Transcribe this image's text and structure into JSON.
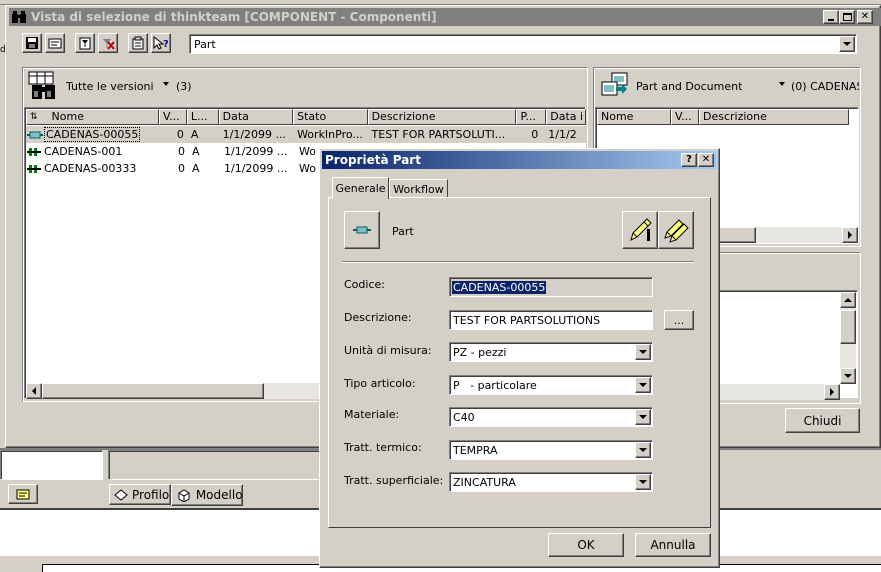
{
  "main_window": {
    "title": "Vista di selezione di thinkteam [COMPONENT - Componenti]",
    "toolbar_combo_value": "Part",
    "left_pane": {
      "versions_label": "Tutte le versioni",
      "count": "(3)",
      "columns": [
        "Nome",
        "V...",
        "L...",
        "Data",
        "Stato",
        "Descrizione",
        "P...",
        "Data i"
      ],
      "rows": [
        {
          "name": "CADENAS-00055",
          "v": "0",
          "l": "A",
          "data": "1/1/2099 ...",
          "stato": "WorkInPro...",
          "descr": "TEST FOR PARTSOLUTI...",
          "p": "0",
          "datai": "1/1/2"
        },
        {
          "name": "CADENAS-001",
          "v": "0",
          "l": "A",
          "data": "1/1/2099 ...",
          "stato": "Wo",
          "descr": "",
          "p": "",
          "datai": ""
        },
        {
          "name": "CADENAS-00333",
          "v": "0",
          "l": "A",
          "data": "1/1/2099 ...",
          "stato": "Wo",
          "descr": "",
          "p": "",
          "datai": ""
        }
      ]
    },
    "right_pane": {
      "label": "Part and Document",
      "count": "(0) CADENAS",
      "columns": [
        "Nome",
        "V...",
        "Descrizione"
      ]
    },
    "close_button": "Chiudi"
  },
  "background": {
    "tab_profilo": "Profilo",
    "tab_modello": "Modello"
  },
  "dialog": {
    "title": "Proprietà Part",
    "help": "?",
    "close": "x",
    "tabs": [
      "Generale",
      "Workflow"
    ],
    "type_label": "Part",
    "fields": {
      "codice_label": "Codice:",
      "codice_value": "CADENAS-00055",
      "descrizione_label": "Descrizione:",
      "descrizione_value": "TEST FOR PARTSOLUTIONS",
      "browse_button": "...",
      "unita_label": "Unità di misura:",
      "unita_value": "PZ - pezzi",
      "tipo_label": "Tipo articolo:",
      "tipo_value": "P   - particolare",
      "materiale_label": "Materiale:",
      "materiale_value": "C40",
      "termico_label": "Tratt. termico:",
      "termico_value": "TEMPRA",
      "superficiale_label": "Tratt. superficiale:",
      "superficiale_value": "ZINCATURA"
    },
    "ok": "OK",
    "cancel": "Annulla"
  },
  "colors": {
    "titlebar_inactive": "#808080",
    "titlebar_active_start": "#0a246a",
    "titlebar_active_end": "#a6caf0",
    "selection": "#0a246a",
    "face": "#d4d0c8"
  }
}
